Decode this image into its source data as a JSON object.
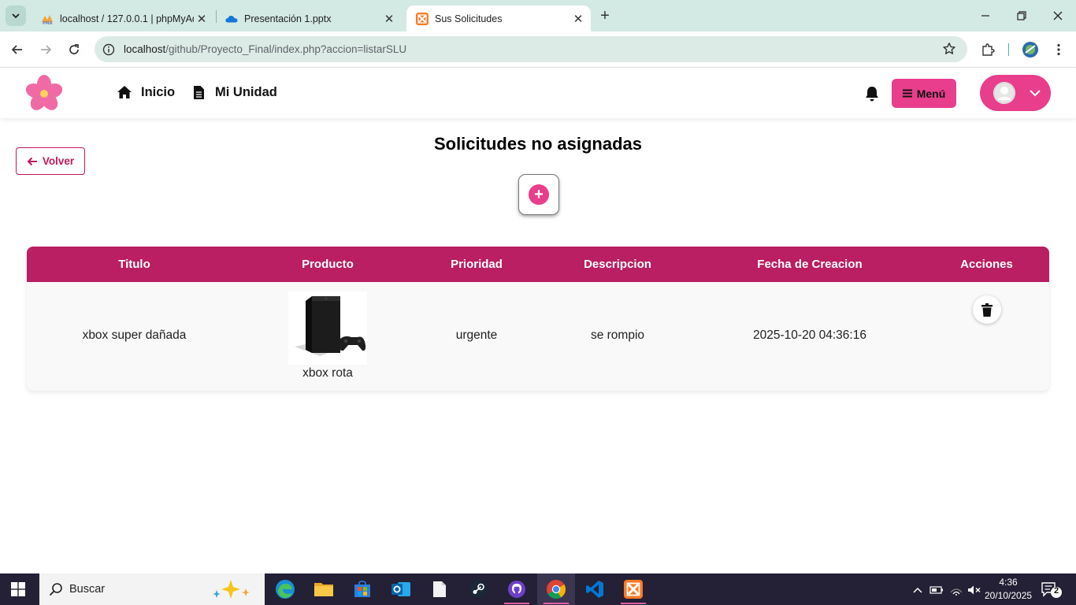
{
  "browser": {
    "tabs": [
      {
        "title": "localhost / 127.0.0.1 | phpMyAd",
        "favicon": "phpmyadmin-icon"
      },
      {
        "title": "Presentación 1.pptx",
        "favicon": "onedrive-icon"
      },
      {
        "title": "Sus Solicitudes",
        "favicon": "xampp-icon",
        "active": true
      }
    ],
    "url_host": "localhost",
    "url_path": "/github/Proyecto_Final/index.php?accion=listarSLU"
  },
  "navbar": {
    "links": [
      {
        "label": "Inicio",
        "icon": "home-icon"
      },
      {
        "label": "Mi Unidad",
        "icon": "file-icon"
      }
    ],
    "menu_label": "Menú"
  },
  "page": {
    "back_label": "Volver",
    "title": "Solicitudes no asignadas",
    "add_symbol": "+"
  },
  "table": {
    "headers": [
      "Titulo",
      "Producto",
      "Prioridad",
      "Descripcion",
      "Fecha de Creacion",
      "Acciones"
    ],
    "rows": [
      {
        "titulo": "xbox super dañada",
        "producto": "xbox rota",
        "prioridad": "urgente",
        "descripcion": "se rompio",
        "fecha": "2025-10-20 04:36:16"
      }
    ]
  },
  "taskbar": {
    "search_placeholder": "Buscar",
    "time": "4:36",
    "date": "20/10/2025",
    "notifications": "2"
  },
  "colors": {
    "accent": "#e83e8c",
    "table_header": "#b91f62",
    "volver_border": "#c2185b",
    "chrome_frame": "#d3e9e3",
    "taskbar": "#242035"
  }
}
